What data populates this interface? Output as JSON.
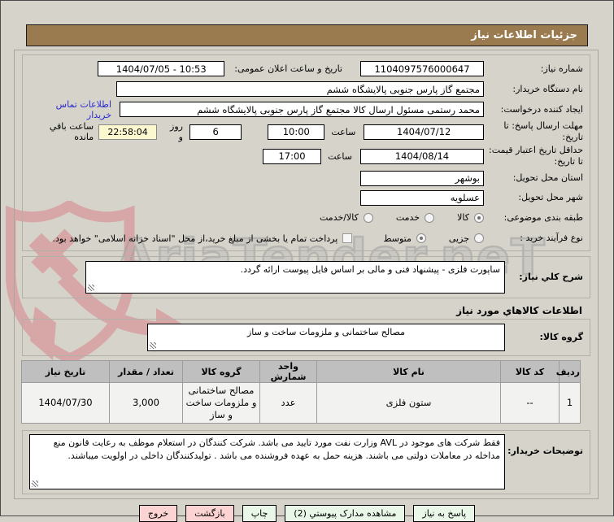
{
  "title": "جزئیات اطلاعات نیاز",
  "watermark": {
    "text": "AriaTender.neT"
  },
  "form": {
    "need_number": {
      "label": "شماره نیاز:",
      "value": "1104097576000647"
    },
    "announce": {
      "label": "تاریخ و ساعت اعلان عمومی:",
      "value": "1404/07/05 - 10:53"
    },
    "buyer_org": {
      "label": "نام دستگاه خریدار:",
      "value": "مجتمع گاز پارس جنوبی  پالایشگاه ششم"
    },
    "creator": {
      "label": "ایجاد کننده درخواست:",
      "value": "محمد رستمی مسئول ارسال کالا مجتمع گاز پارس جنوبی  پالایشگاه ششم",
      "contact_link": "اطلاعات تماس خریدار"
    },
    "deadline": {
      "label": "مهلت ارسال پاسخ: تا تاریخ:",
      "date": "1404/07/12",
      "time_label": "ساعت",
      "time": "10:00",
      "days": "6",
      "days_label": "روز و",
      "countdown": "22:58:04",
      "countdown_label": "ساعت باقي مانده"
    },
    "validity": {
      "label": "حداقل تاریخ اعتبار قیمت: تا تاریخ:",
      "date": "1404/08/14",
      "time_label": "ساعت",
      "time": "17:00"
    },
    "province": {
      "label": "استان محل تحویل:",
      "value": "بوشهر"
    },
    "city": {
      "label": "شهر محل تحویل:",
      "value": "عسلویه"
    },
    "subject_class": {
      "label": "طبقه بندی موضوعی:",
      "options": [
        "کالا",
        "خدمت",
        "کالا/خدمت"
      ],
      "selected": "کالا"
    },
    "process_type": {
      "label": "نوع فرآیند خرید :",
      "options": [
        "جزیی",
        "متوسط"
      ],
      "selected": "متوسط",
      "treasury_note": "پرداخت تمام یا بخشی از مبلغ خرید،از محل \"اسناد خزانه اسلامی\" خواهد بود."
    }
  },
  "need_desc": {
    "label": "شرح کلي نیاز:",
    "value": "ساپورت فلزی -  پیشنهاد فنی و مالی بر اساس فایل پیوست ارائه گردد."
  },
  "goods_section_title": "اطلاعات کالاهاي مورد نياز",
  "goods_group": {
    "label": "گروه کالا:",
    "value": "مصالح ساختمانی و ملزومات ساخت و ساز"
  },
  "table": {
    "headers": [
      "ردیف",
      "کد کالا",
      "نام کالا",
      "واحد شمارش",
      "گروه کالا",
      "تعداد / مقدار",
      "تاریخ نیاز"
    ],
    "rows": [
      [
        "1",
        "--",
        "ستون فلزی",
        "عدد",
        "مصالح ساختمانی و ملزومات ساخت و ساز",
        "3,000",
        "1404/07/30"
      ]
    ]
  },
  "buyer_notes": {
    "label": "توضیحات خریدار:",
    "value": "فقط شرکت های موجود در AVL وزارت نفت مورد تایید می باشد. شرکت کنندگان در استعلام موظف به رعایت قانون منع مداخله در معاملات دولتی می باشند. هزینه حمل به عهده فروشنده می باشد . تولیدکنندگان داخلی در اولویت میباشند."
  },
  "buttons": [
    {
      "label": "پاسخ به نیاز",
      "style": "green"
    },
    {
      "label": "مشاهده مدارک پیوستي (2)",
      "style": "green"
    },
    {
      "label": "چاپ",
      "style": "green"
    },
    {
      "label": "بازگشت",
      "style": "pink"
    },
    {
      "label": "خروج",
      "style": "pink"
    }
  ],
  "colors": {
    "titlebar": "#9a7b50",
    "page_bg": "#d6d3cb",
    "link_blue": "#2a2ad0",
    "countdown_yellow": "#fbf8cf",
    "button_green": "#e9f7e9",
    "button_pink": "#fbd3d3",
    "table_header_gray": "#bfbfbf"
  }
}
